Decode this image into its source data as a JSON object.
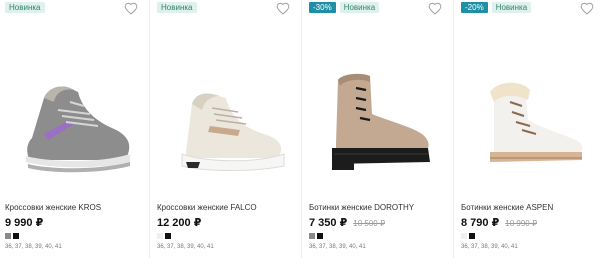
{
  "products": [
    {
      "badges": [
        "Новинка"
      ],
      "name": "Кроссовки женские KROS",
      "price": "9 990 ₽",
      "old_price": "",
      "swatches": [
        "#8a8a8a",
        "#111111"
      ],
      "sizes": "36, 37, 38, 39, 40, 41"
    },
    {
      "badges": [
        "Новинка"
      ],
      "name": "Кроссовки женские FALCO",
      "price": "12 200 ₽",
      "old_price": "",
      "swatches": [
        "#f2efe9",
        "#111111"
      ],
      "sizes": "36, 37, 38, 39, 40, 41"
    },
    {
      "badges": [
        "-30%",
        "Новинка"
      ],
      "name": "Ботинки женские DOROTHY",
      "price": "7 350 ₽",
      "old_price": "10 500 ₽",
      "swatches": [
        "#8a8a8a",
        "#111111"
      ],
      "sizes": "36, 37, 38, 39, 40, 41"
    },
    {
      "badges": [
        "-20%",
        "Новинка"
      ],
      "name": "Ботинки женские ASPEN",
      "price": "8 790 ₽",
      "old_price": "10 990 ₽",
      "swatches": [
        "#f2efe9",
        "#111111"
      ],
      "sizes": "36, 37, 38, 39, 40, 41"
    }
  ],
  "colors": {
    "badge_new_bg": "#dff1ec",
    "badge_new_text": "#37826f",
    "badge_sale_bg": "#1f8fa6",
    "badge_sale_text": "#ffffff"
  },
  "icons": {
    "favorite": "heart-outline-icon"
  }
}
